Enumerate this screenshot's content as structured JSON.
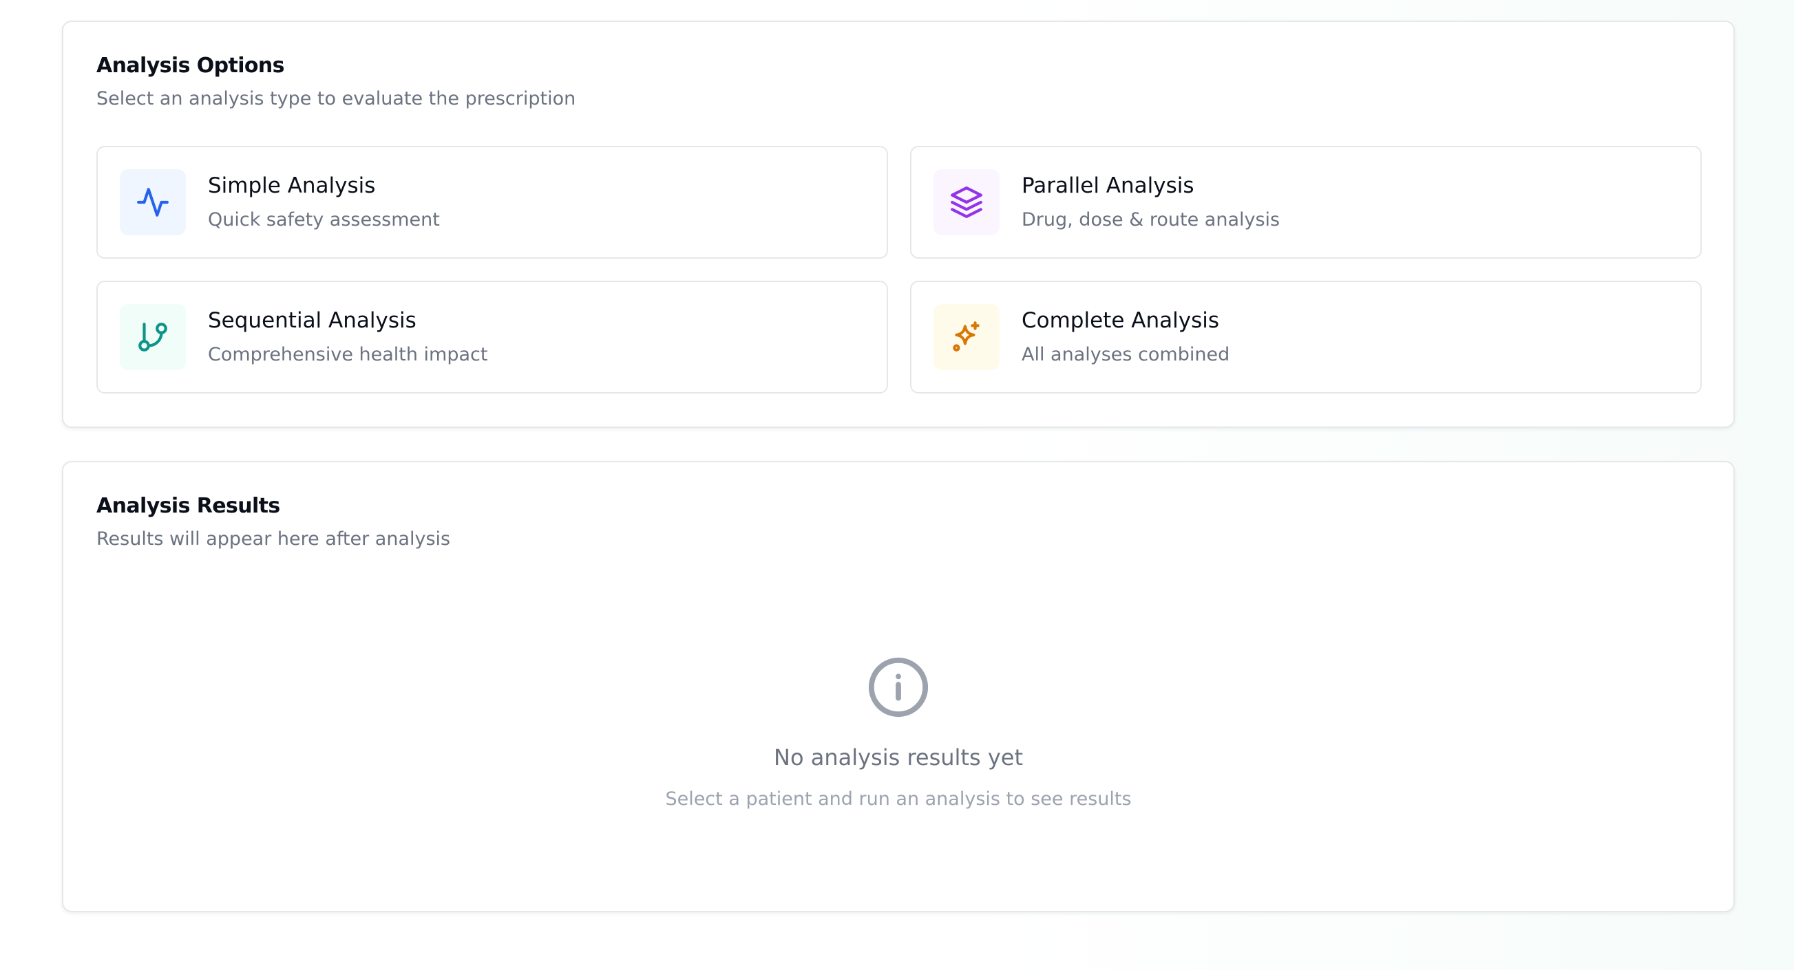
{
  "options": {
    "title": "Analysis Options",
    "subtitle": "Select an analysis type to evaluate the prescription",
    "items": [
      {
        "title": "Simple Analysis",
        "description": "Quick safety assessment",
        "icon": "activity-icon",
        "color": "#2563eb",
        "bg": "#eff6ff"
      },
      {
        "title": "Parallel Analysis",
        "description": "Drug, dose & route analysis",
        "icon": "layers-icon",
        "color": "#9333ea",
        "bg": "#faf5ff"
      },
      {
        "title": "Sequential Analysis",
        "description": "Comprehensive health impact",
        "icon": "git-branch-icon",
        "color": "#0d9488",
        "bg": "#f0fdf9"
      },
      {
        "title": "Complete Analysis",
        "description": "All analyses combined",
        "icon": "sparkles-icon",
        "color": "#d97706",
        "bg": "#fffbeb"
      }
    ]
  },
  "results": {
    "title": "Analysis Results",
    "subtitle": "Results will appear here after analysis",
    "empty_icon": "info-icon",
    "empty_title": "No analysis results yet",
    "empty_subtitle": "Select a patient and run an analysis to see results"
  }
}
